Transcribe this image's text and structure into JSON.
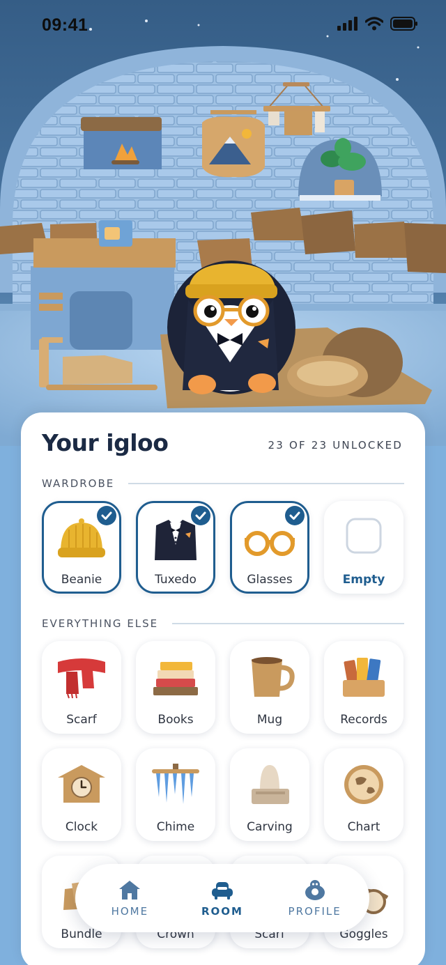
{
  "status_bar": {
    "time": "09:41"
  },
  "sheet": {
    "title": "Your igloo",
    "unlock_count": "23 OF 23 UNLOCKED",
    "sections": {
      "wardrobe": "WARDROBE",
      "everything_else": "EVERYTHING ELSE"
    },
    "wardrobe_items": [
      {
        "label": "Beanie",
        "icon": "beanie-icon",
        "selected": true
      },
      {
        "label": "Tuxedo",
        "icon": "tuxedo-icon",
        "selected": true
      },
      {
        "label": "Glasses",
        "icon": "glasses-icon",
        "selected": true
      },
      {
        "label": "Empty",
        "icon": "empty-slot-icon",
        "selected": false
      }
    ],
    "other_items": [
      {
        "label": "Scarf",
        "icon": "scarf-icon"
      },
      {
        "label": "Books",
        "icon": "books-icon"
      },
      {
        "label": "Mug",
        "icon": "mug-icon"
      },
      {
        "label": "Records",
        "icon": "records-icon"
      },
      {
        "label": "Clock",
        "icon": "clock-icon"
      },
      {
        "label": "Chime",
        "icon": "chime-icon"
      },
      {
        "label": "Carving",
        "icon": "carving-icon"
      },
      {
        "label": "Chart",
        "icon": "chart-icon"
      },
      {
        "label": "Bundle",
        "icon": "bundle-icon"
      },
      {
        "label": "Crown",
        "icon": "crown-icon"
      },
      {
        "label": "Scarf",
        "icon": "scarf-icon"
      },
      {
        "label": "Goggles",
        "icon": "goggles-icon"
      }
    ]
  },
  "nav": {
    "items": [
      {
        "label": "HOME",
        "icon": "home-icon",
        "active": false
      },
      {
        "label": "ROOM",
        "icon": "room-icon",
        "active": true
      },
      {
        "label": "PROFILE",
        "icon": "profile-icon",
        "active": false
      }
    ]
  },
  "colors": {
    "accent": "#1f5d8f",
    "sky": "#355d86",
    "page_bg": "#7fb0dd",
    "wood": "#c99a5e"
  }
}
